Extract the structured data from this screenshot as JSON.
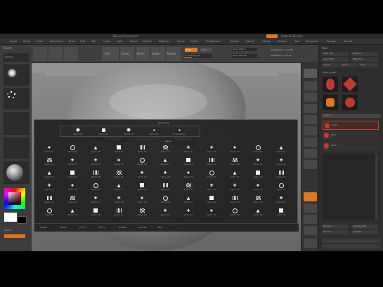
{
  "window": {
    "title": "ZBrush Document",
    "menu_right": "Default ZScript"
  },
  "menu": [
    "Alpha",
    "Brush",
    "Color",
    "Document",
    "Draw",
    "Edit",
    "File",
    "Layer",
    "Light",
    "Macro",
    "Marker",
    "Material",
    "Movie",
    "Picker",
    "Preferences",
    "Render",
    "Stencil",
    "Stroke",
    "Texture",
    "Tool",
    "Transform",
    "Zplugin",
    "Zscript"
  ],
  "left_tray": {
    "header": "Brush",
    "picker_label": "Default",
    "flash_label": "Switch"
  },
  "shelf": {
    "buttons": [
      "Edit",
      "Draw",
      "Move",
      "Scale",
      "Rotate"
    ],
    "fields": [
      "Mrgb",
      "Rgb",
      "M",
      "Zadd",
      "Zsub",
      "Focal Shift 0",
      "Draw Size 64",
      "Z Intensity 25",
      "Rgb Intensity 100",
      "ActivePoints: 1.02 Mil",
      "TotalPoints: 1.02 Mil"
    ]
  },
  "popup": {
    "quick_header": "Quick Pick",
    "alpha_header": "Alpha",
    "quick_items": [
      {
        "icon": "dot",
        "label": "Alpha 01"
      },
      {
        "icon": "square",
        "label": "Alpha 02"
      },
      {
        "icon": "dot",
        "label": "Alpha 03"
      },
      {
        "icon": "small-dot",
        "label": "Alpha 04"
      },
      {
        "icon": "small-dot",
        "label": "BrushAlpha"
      }
    ],
    "grid": [
      [
        "Alpha 01",
        "Alpha 02",
        "Alpha 03",
        "Alpha 04",
        "Alpha 05",
        "Alpha 06",
        "Alpha 07",
        "Alpha 08",
        "Alpha 09",
        "Alpha 10",
        "Alpha 11"
      ],
      [
        "Alpha 12",
        "Alpha 13",
        "Alpha 14",
        "Alpha 15",
        "Alpha 16",
        "Alpha 17",
        "Alpha 18",
        "Alpha 19",
        "Alpha 20",
        "Alpha 21",
        "Alpha 22"
      ],
      [
        "Alpha 23",
        "Alpha 24",
        "Alpha 25",
        "Alpha 26",
        "Alpha 27",
        "Alpha 28",
        "Alpha 29",
        "Alpha 30",
        "Alpha 31",
        "Alpha 32",
        "Alpha 33"
      ],
      [
        "Alpha 34",
        "Alpha 35",
        "Alpha 36",
        "Alpha 37",
        "Alpha 38",
        "Alpha 39",
        "Alpha 40",
        "Alpha 41",
        "Alpha 42",
        "Alpha 43",
        "Alpha 44"
      ],
      [
        "Alpha 45",
        "Alpha 46",
        "Alpha 47",
        "Alpha 48",
        "Alpha 49",
        "Alpha 50",
        "Alpha 51",
        "Alpha 52",
        "Alpha 53",
        "Alpha 54",
        "Alpha 55"
      ],
      [
        "Alpha 56",
        "Alpha 57",
        "Alpha 58",
        "Alpha 59",
        "Alpha 60",
        "Alpha 61",
        "Alpha 62",
        "Alpha 63",
        "Alpha 64",
        "Alpha 65",
        "Alpha 66"
      ]
    ],
    "footer": [
      "Import",
      "Export",
      "Flip H",
      "Flip V",
      "Rotate",
      "Inverse",
      "Mid"
    ]
  },
  "right_panel": {
    "header": "Tool",
    "buttons": [
      "Load Tool",
      "Save As",
      "Copy Tool",
      "Paste Tool",
      "Import",
      "Export",
      "Clone",
      "Make PolyMesh3D",
      "GoZ",
      "All",
      "Visible"
    ],
    "tool_label": "Head_Sculpt",
    "subtool_header": "SubTool",
    "subtools": [
      "Head",
      "Eyes",
      "Teeth"
    ],
    "bottom": [
      "Rename",
      "AutoReorder",
      "All Low",
      "All High"
    ]
  },
  "colors": {
    "accent": "#e0761e",
    "selected": "#c2442e",
    "panel": "#2e2e2e"
  }
}
